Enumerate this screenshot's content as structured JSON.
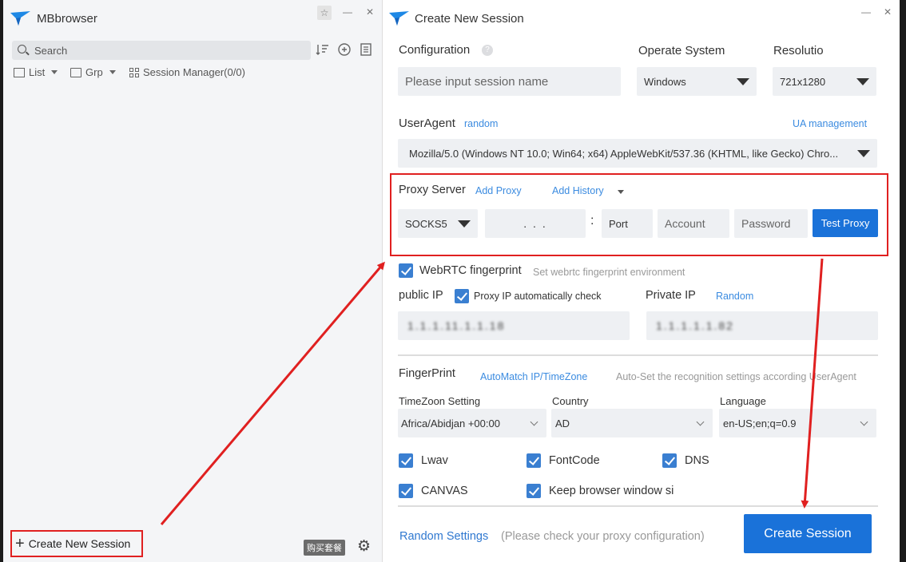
{
  "left": {
    "title": "MBbrowser",
    "search_placeholder": "Search",
    "toolbar": {
      "list": "List",
      "grp": "Grp",
      "session_manager": "Session Manager(0/0)"
    },
    "create_new_session": "Create New Session",
    "buy_badge": "购买套餐"
  },
  "dialog": {
    "title": "Create New Session",
    "configuration": "Configuration",
    "session_name_placeholder": "Please input session name",
    "operate_system_label": "Operate System",
    "operate_system_value": "Windows",
    "resolution_label": "Resolutio",
    "resolution_value": "721x1280",
    "useragent_label": "UserAgent",
    "ua_random": "random",
    "ua_management": "UA management",
    "ua_value": "Mozilla/5.0 (Windows NT 10.0; Win64; x64) AppleWebKit/537.36 (KHTML, like Gecko) Chro...",
    "proxy": {
      "label": "Proxy Server",
      "add_proxy": "Add Proxy",
      "add_history": "Add History",
      "type": "SOCKS5",
      "ip": ".     .     .",
      "colon": ":",
      "port_placeholder": "Port",
      "account_placeholder": "Account",
      "password_placeholder": "Password",
      "test_button": "Test Proxy"
    },
    "webrtc_label": "WebRTC fingerprint",
    "webrtc_hint": "Set webrtc fingerprint environment",
    "public_ip_label": "public IP",
    "proxy_ip_check": "Proxy IP automatically check",
    "public_ip_value": "1.1.1.11.1.1.18",
    "private_ip_label": "Private IP",
    "private_ip_random": "Random",
    "private_ip_value": "1.1.1.1.1.82",
    "fingerprint_label": "FingerPrint",
    "automatch": "AutoMatch IP/TimeZone",
    "autoset_hint": "Auto-Set the recognition settings according UserAgent",
    "timezone_label": "TimeZoon Setting",
    "timezone_value": "Africa/Abidjan +00:00",
    "country_label": "Country",
    "country_value": "AD",
    "language_label": "Language",
    "language_value": "en-US;en;q=0.9",
    "checks": {
      "lwav": "Lwav",
      "fontcode": "FontCode",
      "dns": "DNS",
      "canvas": "CANVAS",
      "keep_window": "Keep browser window si"
    },
    "random_settings": "Random Settings",
    "proxy_check_note": "(Please check your proxy configuration)",
    "create_session_button": "Create Session"
  },
  "colors": {
    "accent": "#1a72d9",
    "link": "#3b8be0",
    "highlight": "#e02020",
    "checkbox": "#3a7fd1"
  }
}
